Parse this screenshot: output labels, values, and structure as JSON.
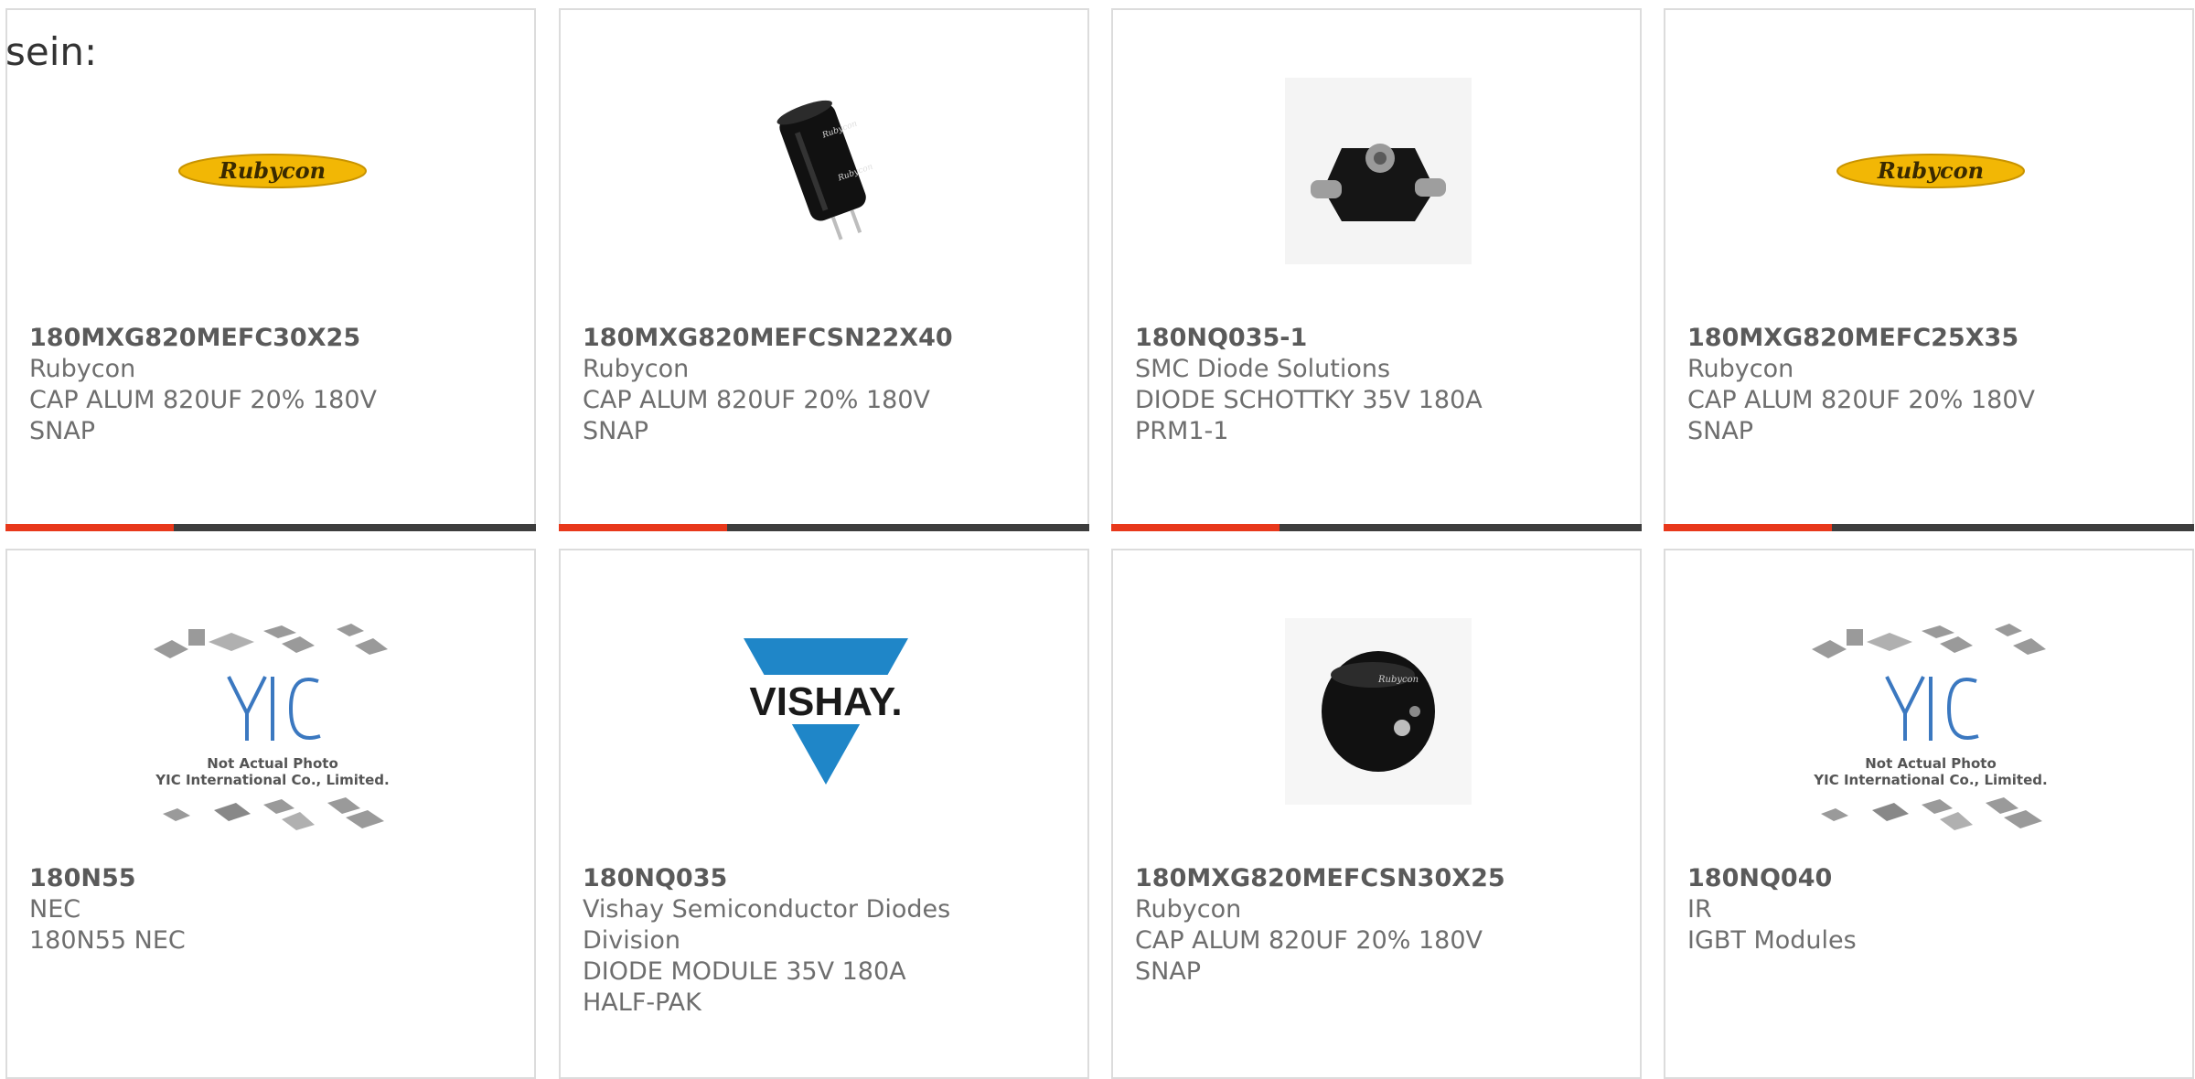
{
  "intro_text": "sein:",
  "colors": {
    "accent": "#e8381b",
    "bar": "#3d3d3d",
    "border": "#dcdcdc",
    "text": "#6e6e6e"
  },
  "products": [
    {
      "part_number": "180MXG820MEFC30X25",
      "manufacturer": "Rubycon",
      "description": "CAP ALUM 820UF 20% 180V SNAP",
      "image": "rubycon-logo"
    },
    {
      "part_number": "180MXG820MEFCSN22X40",
      "manufacturer": "Rubycon",
      "description": "CAP ALUM 820UF 20% 180V SNAP",
      "image": "capacitor-tall-photo"
    },
    {
      "part_number": "180NQ035-1",
      "manufacturer": "SMC Diode Solutions",
      "description": "DIODE SCHOTTKY 35V 180A PRM1-1",
      "image": "diode-module-photo"
    },
    {
      "part_number": "180MXG820MEFC25X35",
      "manufacturer": "Rubycon",
      "description": "CAP ALUM 820UF 20% 180V SNAP",
      "image": "rubycon-logo"
    },
    {
      "part_number": "180N55",
      "manufacturer": "NEC",
      "description": "180N55 NEC",
      "image": "yic-placeholder",
      "placeholder_lines": [
        "Not Actual Photo",
        "YIC International Co., Limited."
      ]
    },
    {
      "part_number": "180NQ035",
      "manufacturer": "Vishay Semiconductor Diodes Division",
      "description": "DIODE MODULE 35V 180A HALF-PAK",
      "image": "vishay-logo"
    },
    {
      "part_number": "180MXG820MEFCSN30X25",
      "manufacturer": "Rubycon",
      "description": "CAP ALUM 820UF 20% 180V SNAP",
      "image": "capacitor-short-photo"
    },
    {
      "part_number": "180NQ040",
      "manufacturer": "IR",
      "description": "IGBT Modules",
      "image": "yic-placeholder",
      "placeholder_lines": [
        "Not Actual Photo",
        "YIC International Co., Limited."
      ]
    }
  ],
  "logos": {
    "rubycon": "Rubycon",
    "vishay": "VISHAY."
  }
}
